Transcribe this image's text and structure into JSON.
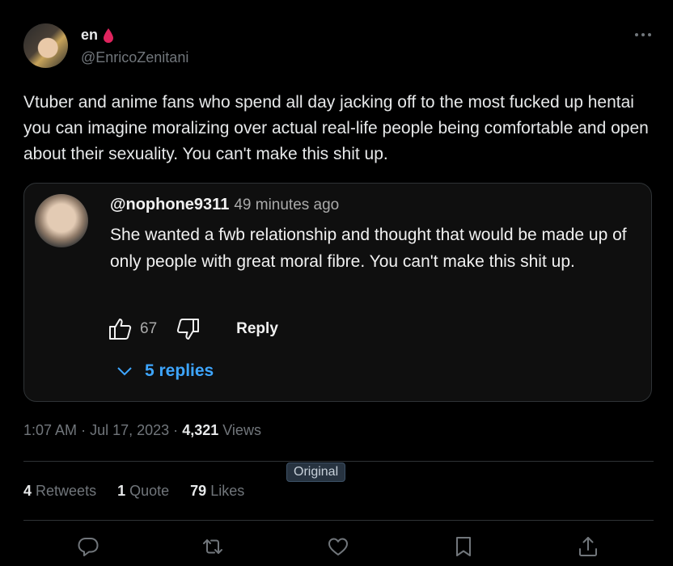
{
  "author": {
    "display_name": "en",
    "handle": "@EnricoZenitani"
  },
  "tweet": {
    "text": "Vtuber and anime fans who spend all day jacking off to the most fucked up hentai you can imagine moralizing over actual real-life people being comfortable and open about their sexuality. You can't make this shit up."
  },
  "quoted_comment": {
    "username": "@nophone9311",
    "time": "49 minutes ago",
    "text": "She wanted a fwb relationship and thought that would be made up of only people with great moral fibre. You can't make this shit up.",
    "likes": "67",
    "reply_label": "Reply",
    "replies_label": "5 replies",
    "replies_color": "#3ea6ff"
  },
  "meta": {
    "time": "1:07 AM",
    "separator": "·",
    "date": "Jul 17, 2023",
    "views_count": "4,321",
    "views_label": "Views"
  },
  "badge": {
    "label": "Original"
  },
  "stats": {
    "retweets_count": "4",
    "retweets_label": "Retweets",
    "quotes_count": "1",
    "quotes_label": "Quote",
    "likes_count": "79",
    "likes_label": "Likes"
  },
  "icons": {
    "name_emoji": "blood-drop-icon",
    "more": "more-icon",
    "reply": "reply-icon",
    "retweet": "retweet-icon",
    "like": "like-icon",
    "bookmark": "bookmark-icon",
    "share": "share-icon"
  },
  "colors": {
    "background": "#000000",
    "text_primary": "#e7e9ea",
    "text_secondary": "#71767b",
    "drop": "#e0245e"
  }
}
